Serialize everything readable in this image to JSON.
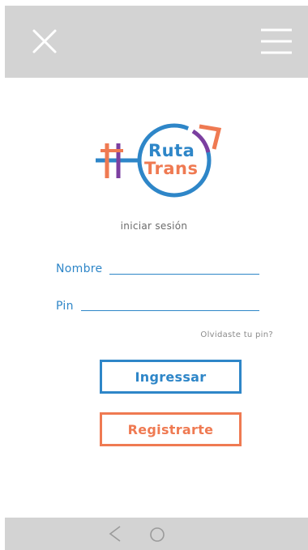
{
  "header": {
    "close_icon": "close-icon",
    "menu_icon": "hamburger-menu-icon"
  },
  "logo": {
    "line1": "Ruta",
    "line2": "Trans",
    "colors": {
      "blue": "#2e86c8",
      "orange": "#ef7a52",
      "purple": "#7b3fa0"
    }
  },
  "login": {
    "subtitle": "iniciar sesión",
    "name_label": "Nombre",
    "pin_label": "Pin",
    "forgot_link": "Olvidaste tu pin?",
    "login_button": "Ingressar",
    "register_button": "Registrarte"
  },
  "navbar": {
    "back_icon": "back-arrow-icon",
    "home_icon": "home-circle-icon"
  },
  "colors": {
    "topbar_bg": "#d3d3d3",
    "accent_blue": "#2e86c8",
    "accent_orange": "#ef7a52"
  }
}
